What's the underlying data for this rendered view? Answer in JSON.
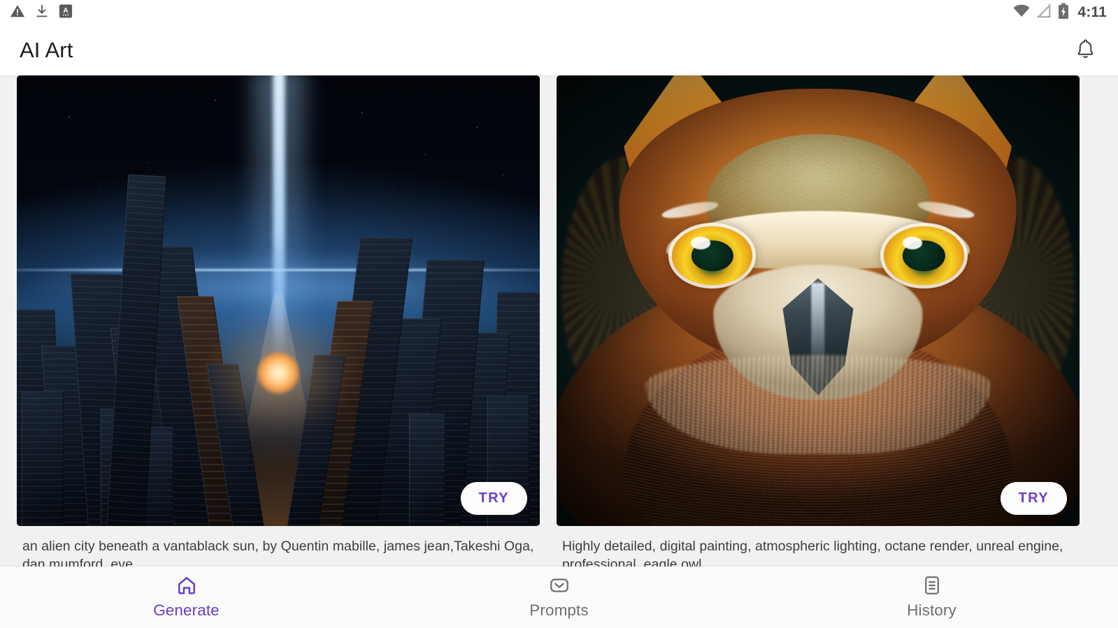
{
  "status_bar": {
    "icons_left": [
      "warning-triangle-icon",
      "download-icon",
      "app-badge-icon"
    ],
    "icons_right": [
      "wifi-icon",
      "signal-off-icon",
      "battery-charging-icon"
    ],
    "time": "4:11"
  },
  "app_bar": {
    "title": "AI Art",
    "notification_icon": "bell-icon"
  },
  "cards": [
    {
      "art": "alien-city",
      "try_label": "TRY",
      "caption": "an alien city beneath a vantablack sun, by Quentin mabille, james jean,Takeshi Oga, dan mumford, eve"
    },
    {
      "art": "eagle-owl",
      "try_label": "TRY",
      "caption": "Highly detailed, digital painting, atmospheric lighting, octane render, unreal engine, professional, eagle owl"
    }
  ],
  "bottom_nav": {
    "items": [
      {
        "label": "Generate",
        "icon": "home-icon",
        "active": true
      },
      {
        "label": "Prompts",
        "icon": "mail-icon",
        "active": false
      },
      {
        "label": "History",
        "icon": "document-list-icon",
        "active": false
      }
    ]
  },
  "colors": {
    "accent_purple": "#6a3fc6",
    "page_background": "#f1f1f1",
    "app_bar_background": "#ffffff",
    "nav_inactive": "#6f6f6f"
  }
}
